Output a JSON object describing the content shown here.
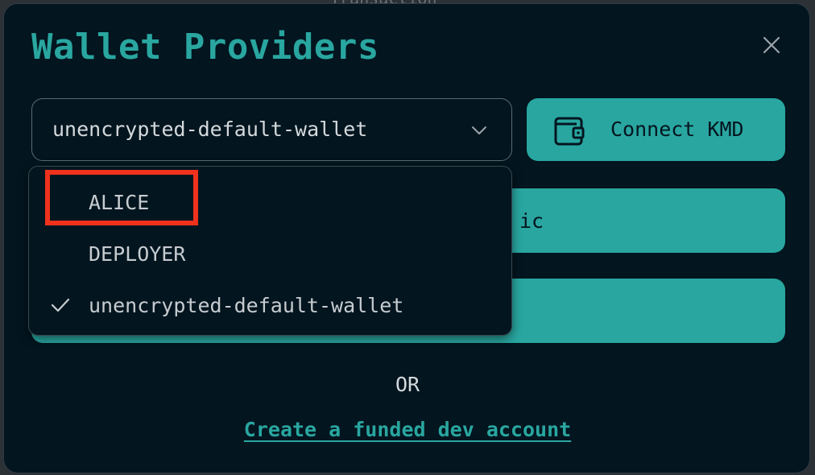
{
  "background": {
    "partial_text": "Transaction"
  },
  "modal": {
    "title": "Wallet Providers",
    "close_icon": "close-icon"
  },
  "wallet_select": {
    "value": "unencrypted-default-wallet",
    "icon": "chevron-down-icon",
    "options": [
      {
        "label": "ALICE",
        "selected": false
      },
      {
        "label": "DEPLOYER",
        "selected": false
      },
      {
        "label": "unencrypted-default-wallet",
        "selected": true
      }
    ]
  },
  "buttons": {
    "connect_kmd": {
      "label": "Connect KMD",
      "icon": "wallet-icon"
    },
    "second_partial_label": "ic",
    "third_partial_label": ""
  },
  "divider_text": "OR",
  "dev_account_link": "Create a funded dev account",
  "annotation": {
    "highlight_color": "#f0321c",
    "target": "ALICE"
  },
  "colors": {
    "accent": "#29a6a0",
    "modal_bg": "#03151f",
    "text": "#d4d9dc"
  }
}
